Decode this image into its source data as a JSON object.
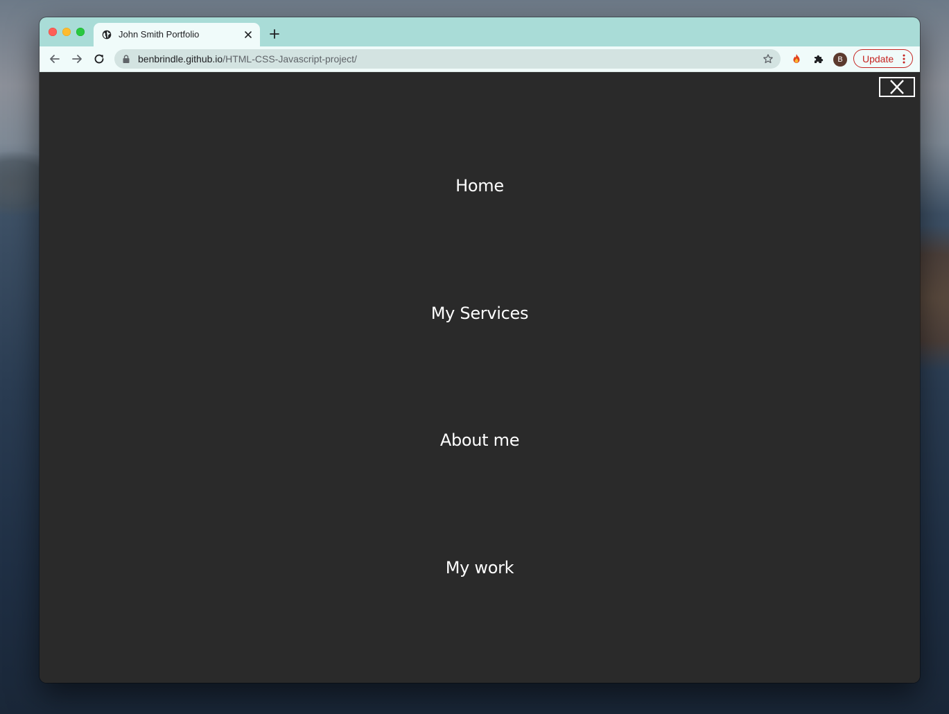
{
  "browser": {
    "tab": {
      "title": "John Smith Portfolio"
    },
    "address_bar": {
      "host": "benbrindle.github.io",
      "path": "/HTML-CSS-Javascript-project/"
    },
    "profile_initial": "B",
    "update_label": "Update",
    "colors": {
      "frame": "#a9dcd7",
      "toolbar": "#f0fbfa",
      "update_accent": "#c5221f"
    },
    "icons": [
      "globe-icon",
      "close-icon",
      "plus-icon",
      "back-arrow-icon",
      "forward-arrow-icon",
      "reload-icon",
      "lock-icon",
      "star-icon",
      "fire-extension-icon",
      "puzzle-icon",
      "kebab-menu-icon"
    ]
  },
  "page": {
    "background": "#2a2a2a",
    "close_icon": "close-icon",
    "menu": [
      {
        "label": "Home"
      },
      {
        "label": "My Services"
      },
      {
        "label": "About me"
      },
      {
        "label": "My work"
      }
    ]
  }
}
